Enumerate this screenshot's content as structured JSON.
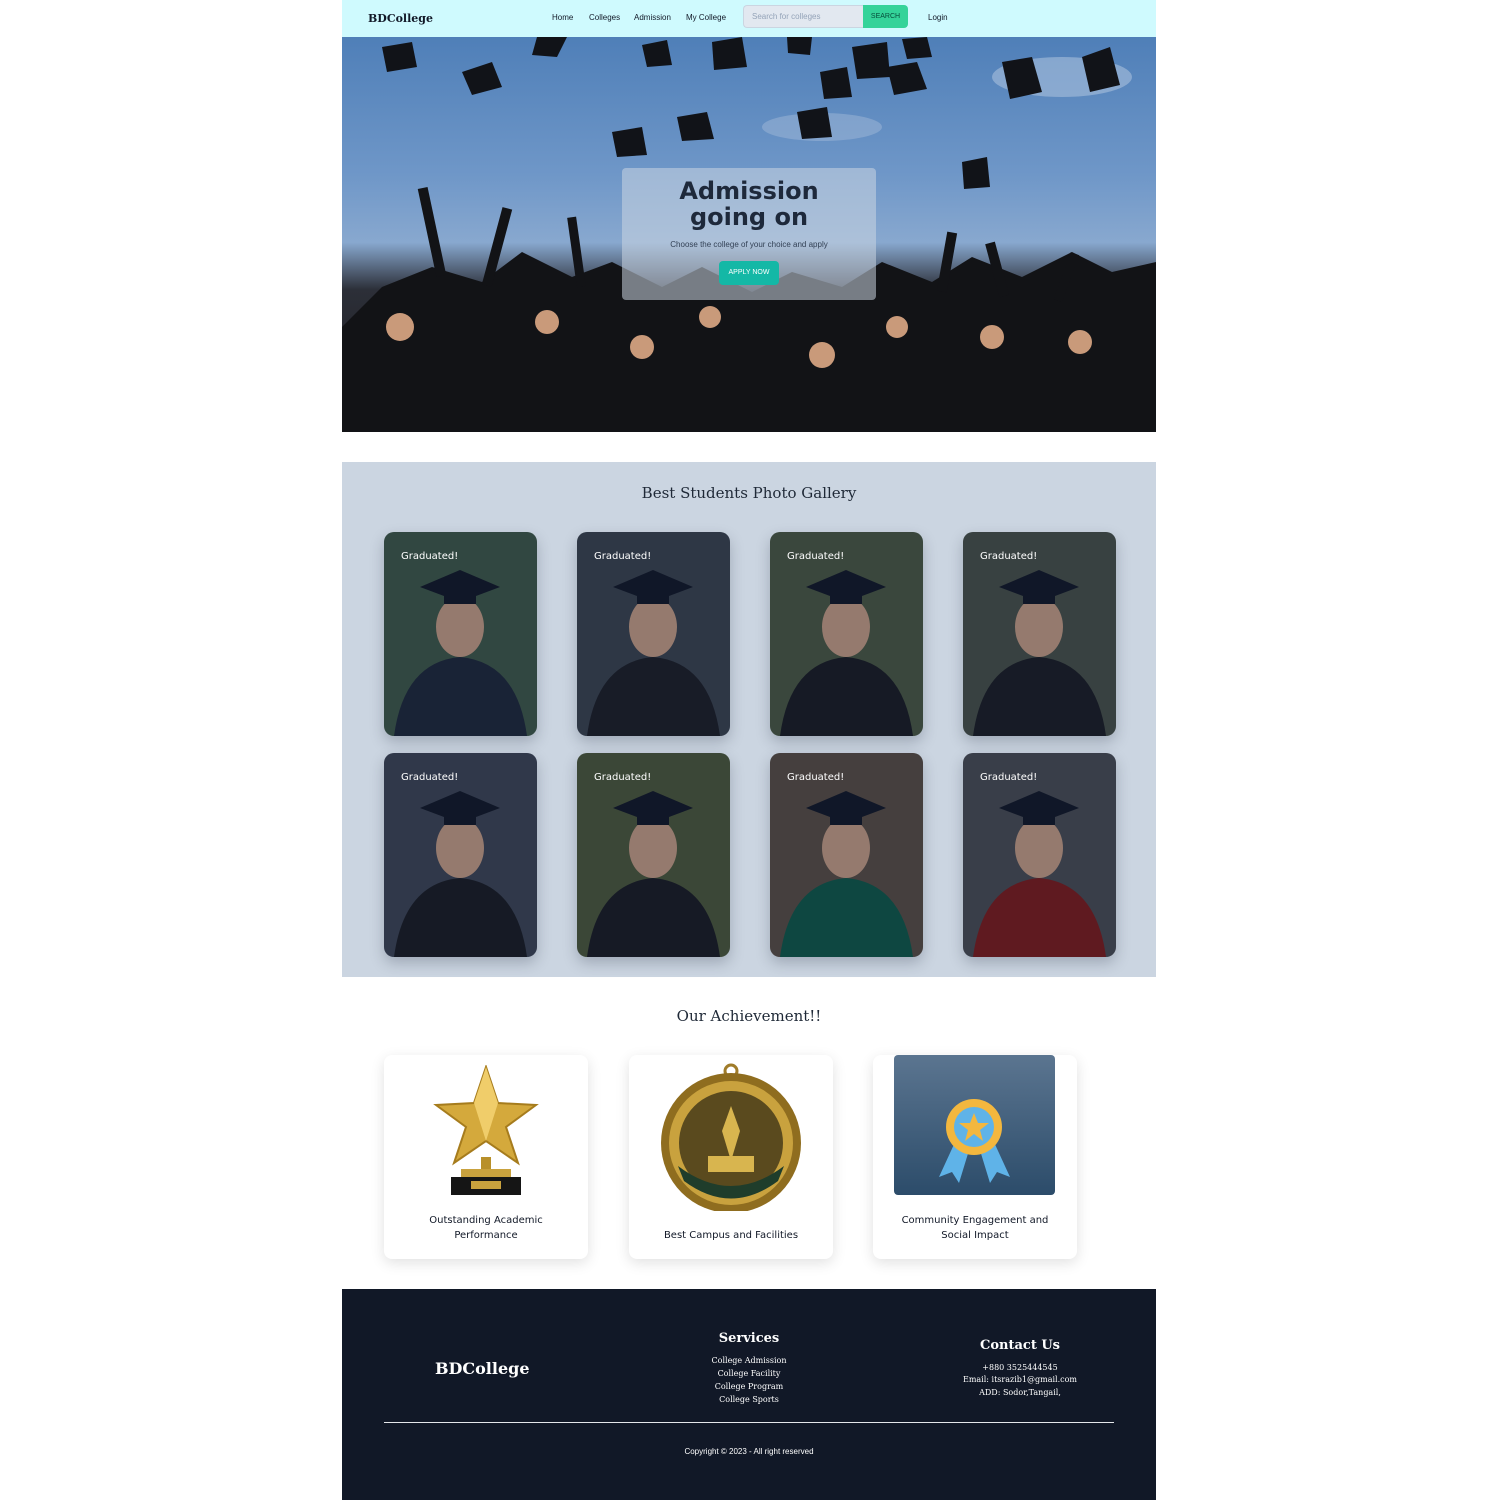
{
  "navbar": {
    "brand": "BDCollege",
    "links": [
      "Home",
      "Colleges",
      "Admission",
      "My College"
    ],
    "search_placeholder": "Search for colleges",
    "search_button": "SEARCH",
    "login": "Login"
  },
  "hero": {
    "title": "Admission going on",
    "subtitle": "Choose the college of your choice and apply",
    "button": "APPLY NOW"
  },
  "gallery": {
    "title": "Best Students Photo Gallery",
    "cards": [
      {
        "label": "Graduated!",
        "bg": "#3f5a4a",
        "gown": "#1e293b"
      },
      {
        "label": "Graduated!",
        "bg": "#3b4450",
        "gown": "#1c1f26"
      },
      {
        "label": "Graduated!",
        "bg": "#4b5a44",
        "gown": "#1a1d23"
      },
      {
        "label": "Graduated!",
        "bg": "#49534a",
        "gown": "#1b1e24"
      },
      {
        "label": "Graduated!",
        "bg": "#3d4656",
        "gown": "#1a1d23"
      },
      {
        "label": "Graduated!",
        "bg": "#4d5a3c",
        "gown": "#1a1d23"
      },
      {
        "label": "Graduated!",
        "bg": "#5a5046",
        "gown": "#0f5b4a"
      },
      {
        "label": "Graduated!",
        "bg": "#4a4e55",
        "gown": "#7f1d1d"
      }
    ]
  },
  "achievements": {
    "title": "Our Achievement!!",
    "items": [
      {
        "label": "Outstanding Academic Performance",
        "icon": "trophy-star-icon"
      },
      {
        "label": "Best Campus and Facilities",
        "icon": "medal-icon"
      },
      {
        "label": "Community Engagement and Social Impact",
        "icon": "award-ribbon-icon"
      }
    ]
  },
  "footer": {
    "brand": "BDCollege",
    "services_title": "Services",
    "services": [
      "College Admission",
      "College Facility",
      "College Program",
      "College Sports"
    ],
    "contact_title": "Contact Us",
    "contact": [
      "+880 3525444545",
      "Email: itsrazib1@gmail.com",
      "ADD: Sodor,Tangail,"
    ],
    "copyright": "Copyright © 2023 - All right reserved"
  },
  "colors": {
    "navbar_bg": "#cffafe",
    "search_button": "#34d399",
    "apply_button": "#14b8a6",
    "gallery_bg": "#cbd5e1",
    "footer_bg": "#111827"
  }
}
